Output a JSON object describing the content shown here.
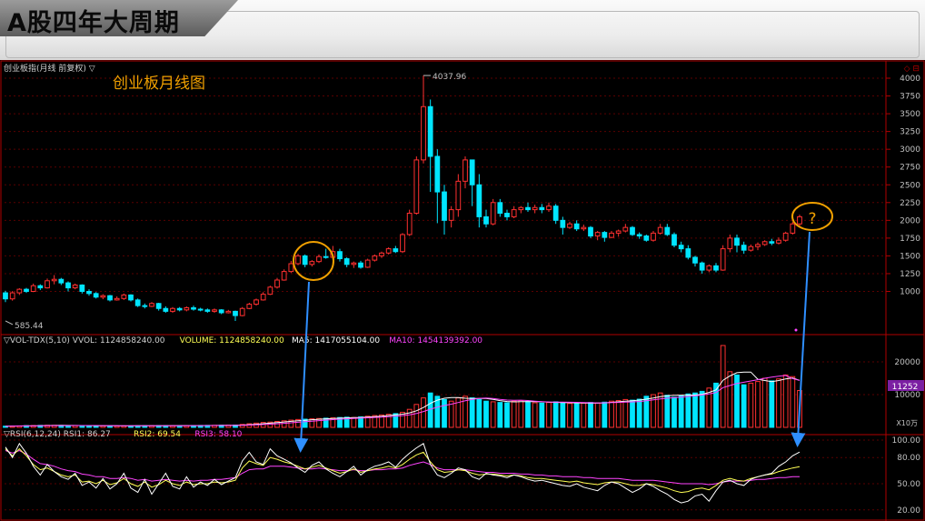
{
  "banner": {
    "title": "A股四年大周期"
  },
  "header": {
    "instrument": "创业板指(月线 前复权) ▽",
    "corner_marks": "◇ ⊟"
  },
  "annotation": {
    "title": "创业板月线图",
    "question": "?"
  },
  "colors": {
    "up": "#ff3030",
    "down": "#00e5ff",
    "ma5": "#ffffff",
    "ma10": "#ff44ff",
    "rsi1": "#ffffff",
    "rsi2": "#ffff55",
    "rsi3": "#ff44ff",
    "highlight": "#f0a000",
    "arrow": "#2f8fff"
  },
  "vol_legend": [
    {
      "text": "▽VOL-TDX(5,10) VVOL: 1124858240.00",
      "color": "#d0d0d0"
    },
    {
      "text": "VOLUME: 1124858240.00",
      "color": "#ffff55"
    },
    {
      "text": "MA5: 1417055104.00",
      "color": "#ffffff"
    },
    {
      "text": "MA10: 1454139392.00",
      "color": "#ff44ff"
    }
  ],
  "rsi_legend": [
    {
      "text": "▽RSI(6,12,24) RSI1: 86.27",
      "color": "#d0d0d0"
    },
    {
      "text": "RSI2: 69.54",
      "color": "#ffff55"
    },
    {
      "text": "RSI3: 58.10",
      "color": "#ff44ff"
    }
  ],
  "chart_data": {
    "type": "candlestick",
    "price_axis": {
      "ticks": [
        "4000",
        "3750",
        "3500",
        "3250",
        "3000",
        "2750",
        "2500",
        "2250",
        "2000",
        "1750",
        "1500",
        "1250",
        "1000"
      ],
      "range": [
        700,
        4150
      ]
    },
    "volume_axis": {
      "ticks": [
        "20000",
        "10000"
      ],
      "unit": "X10万",
      "current_label": "11252",
      "range": [
        0,
        27000
      ]
    },
    "rsi_axis": {
      "ticks": [
        "100.00",
        "80.00",
        "50.00",
        "20.00"
      ],
      "range": [
        15,
        105
      ]
    },
    "markers": {
      "high": "4037.96",
      "low": "585.44"
    },
    "candles": [
      [
        980,
        895,
        1010,
        850
      ],
      [
        895,
        980,
        1005,
        870
      ],
      [
        980,
        1030,
        1045,
        950
      ],
      [
        1030,
        1000,
        1050,
        980
      ],
      [
        1000,
        1080,
        1110,
        990
      ],
      [
        1080,
        1050,
        1100,
        1020
      ],
      [
        1050,
        1150,
        1180,
        1040
      ],
      [
        1150,
        1170,
        1230,
        1100
      ],
      [
        1170,
        1120,
        1190,
        1090
      ],
      [
        1120,
        1050,
        1140,
        1000
      ],
      [
        1050,
        1090,
        1110,
        1030
      ],
      [
        1090,
        1000,
        1100,
        970
      ],
      [
        1000,
        970,
        1030,
        940
      ],
      [
        970,
        920,
        990,
        900
      ],
      [
        920,
        940,
        960,
        890
      ],
      [
        940,
        880,
        950,
        860
      ],
      [
        880,
        900,
        930,
        870
      ],
      [
        900,
        950,
        970,
        880
      ],
      [
        950,
        880,
        960,
        860
      ],
      [
        880,
        800,
        900,
        780
      ],
      [
        800,
        790,
        830,
        760
      ],
      [
        790,
        830,
        850,
        780
      ],
      [
        830,
        760,
        840,
        730
      ],
      [
        760,
        720,
        790,
        700
      ],
      [
        720,
        760,
        780,
        700
      ],
      [
        760,
        740,
        780,
        720
      ],
      [
        740,
        770,
        790,
        720
      ],
      [
        770,
        750,
        800,
        730
      ],
      [
        750,
        740,
        770,
        720
      ],
      [
        740,
        720,
        760,
        700
      ],
      [
        720,
        740,
        760,
        700
      ],
      [
        740,
        700,
        750,
        680
      ],
      [
        700,
        720,
        740,
        690
      ],
      [
        720,
        660,
        730,
        585
      ],
      [
        660,
        760,
        780,
        650
      ],
      [
        760,
        820,
        840,
        750
      ],
      [
        820,
        880,
        900,
        800
      ],
      [
        880,
        960,
        990,
        870
      ],
      [
        960,
        1060,
        1080,
        950
      ],
      [
        1060,
        1160,
        1190,
        1040
      ],
      [
        1160,
        1280,
        1310,
        1150
      ],
      [
        1280,
        1390,
        1430,
        1260
      ],
      [
        1390,
        1500,
        1530,
        1370
      ],
      [
        1500,
        1380,
        1520,
        1340
      ],
      [
        1380,
        1420,
        1440,
        1350
      ],
      [
        1420,
        1490,
        1520,
        1400
      ],
      [
        1490,
        1480,
        1600,
        1460
      ],
      [
        1480,
        1560,
        1640,
        1460
      ],
      [
        1560,
        1460,
        1600,
        1420
      ],
      [
        1460,
        1380,
        1480,
        1340
      ],
      [
        1380,
        1400,
        1420,
        1330
      ],
      [
        1400,
        1340,
        1430,
        1320
      ],
      [
        1340,
        1440,
        1460,
        1330
      ],
      [
        1440,
        1500,
        1520,
        1420
      ],
      [
        1500,
        1540,
        1560,
        1470
      ],
      [
        1540,
        1600,
        1620,
        1520
      ],
      [
        1600,
        1560,
        1640,
        1540
      ],
      [
        1560,
        1800,
        1820,
        1540
      ],
      [
        1800,
        2100,
        2150,
        1780
      ],
      [
        2100,
        2850,
        2900,
        2080
      ],
      [
        2850,
        3600,
        4037.96,
        2800
      ],
      [
        3600,
        2900,
        3700,
        2400
      ],
      [
        2900,
        2400,
        3000,
        1960
      ],
      [
        2400,
        2000,
        2500,
        1800
      ],
      [
        2000,
        2150,
        2200,
        1900
      ],
      [
        2150,
        2550,
        2650,
        2050
      ],
      [
        2550,
        2850,
        2900,
        2450
      ],
      [
        2850,
        2500,
        2850,
        2200
      ],
      [
        2500,
        2050,
        2650,
        1900
      ],
      [
        2050,
        1950,
        2150,
        1900
      ],
      [
        1950,
        2250,
        2300,
        1930
      ],
      [
        2250,
        2100,
        2300,
        2050
      ],
      [
        2100,
        2050,
        2150,
        2000
      ],
      [
        2050,
        2150,
        2200,
        2030
      ],
      [
        2150,
        2180,
        2200,
        2100
      ],
      [
        2180,
        2150,
        2250,
        2120
      ],
      [
        2150,
        2180,
        2220,
        2100
      ],
      [
        2180,
        2150,
        2230,
        2100
      ],
      [
        2150,
        2200,
        2250,
        2120
      ],
      [
        2200,
        2000,
        2230,
        1950
      ],
      [
        2000,
        1900,
        2050,
        1800
      ],
      [
        1900,
        1950,
        1980,
        1880
      ],
      [
        1950,
        1880,
        2000,
        1850
      ],
      [
        1880,
        1900,
        1940,
        1850
      ],
      [
        1900,
        1780,
        1920,
        1750
      ],
      [
        1780,
        1830,
        1850,
        1720
      ],
      [
        1830,
        1760,
        1850,
        1700
      ],
      [
        1760,
        1820,
        1850,
        1750
      ],
      [
        1820,
        1850,
        1870,
        1770
      ],
      [
        1850,
        1900,
        1950,
        1830
      ],
      [
        1900,
        1800,
        1920,
        1780
      ],
      [
        1800,
        1780,
        1830,
        1740
      ],
      [
        1780,
        1720,
        1800,
        1700
      ],
      [
        1720,
        1820,
        1850,
        1700
      ],
      [
        1820,
        1900,
        1950,
        1800
      ],
      [
        1900,
        1800,
        1950,
        1780
      ],
      [
        1800,
        1650,
        1830,
        1620
      ],
      [
        1650,
        1600,
        1700,
        1550
      ],
      [
        1600,
        1480,
        1650,
        1450
      ],
      [
        1480,
        1400,
        1500,
        1350
      ],
      [
        1400,
        1300,
        1420,
        1250
      ],
      [
        1300,
        1360,
        1380,
        1270
      ],
      [
        1360,
        1300,
        1400,
        1270
      ],
      [
        1300,
        1600,
        1650,
        1290
      ],
      [
        1600,
        1750,
        1800,
        1550
      ],
      [
        1750,
        1650,
        1800,
        1550
      ],
      [
        1650,
        1580,
        1700,
        1530
      ],
      [
        1580,
        1630,
        1660,
        1560
      ],
      [
        1630,
        1660,
        1690,
        1580
      ],
      [
        1660,
        1700,
        1720,
        1640
      ],
      [
        1700,
        1680,
        1740,
        1650
      ],
      [
        1680,
        1720,
        1760,
        1660
      ],
      [
        1720,
        1820,
        1840,
        1700
      ],
      [
        1820,
        1950,
        1980,
        1800
      ],
      [
        1950,
        2050,
        2080,
        1900
      ]
    ],
    "volume": [
      360,
      400,
      450,
      520,
      560,
      600,
      640,
      620,
      580,
      540,
      520,
      500,
      480,
      460,
      470,
      450,
      440,
      460,
      470,
      480,
      500,
      520,
      540,
      520,
      500,
      520,
      540,
      560,
      580,
      600,
      620,
      640,
      680,
      700,
      900,
      1100,
      1300,
      1500,
      1600,
      1800,
      2000,
      2200,
      2400,
      2500,
      2600,
      2700,
      2800,
      2900,
      3000,
      3100,
      3000,
      3200,
      3400,
      3600,
      3800,
      4000,
      4200,
      4600,
      5500,
      7000,
      9000,
      10500,
      9500,
      8500,
      8000,
      9000,
      9500,
      9000,
      8500,
      8000,
      7800,
      7600,
      7500,
      8000,
      8200,
      7900,
      7500,
      7400,
      7600,
      7800,
      7500,
      7300,
      7200,
      7400,
      7600,
      7500,
      7700,
      8000,
      8200,
      8500,
      8300,
      8600,
      9500,
      10000,
      10500,
      9800,
      9200,
      9600,
      10200,
      10500,
      11000,
      12000,
      13500,
      25000,
      17000,
      16000,
      13000,
      13500,
      14000,
      15000,
      14200,
      14800,
      16000,
      15500,
      11252
    ],
    "rsi": {
      "rsi1": [
        92,
        80,
        96,
        85,
        70,
        60,
        72,
        64,
        58,
        55,
        62,
        48,
        52,
        45,
        56,
        44,
        50,
        62,
        45,
        40,
        55,
        38,
        50,
        62,
        47,
        44,
        58,
        46,
        52,
        48,
        55,
        49,
        53,
        57,
        76,
        86,
        75,
        72,
        90,
        82,
        78,
        74,
        68,
        63,
        71,
        75,
        67,
        62,
        58,
        64,
        70,
        60,
        66,
        70,
        72,
        75,
        69,
        78,
        85,
        91,
        96,
        72,
        60,
        57,
        62,
        68,
        66,
        58,
        55,
        62,
        60,
        59,
        57,
        60,
        58,
        55,
        53,
        54,
        52,
        50,
        48,
        47,
        50,
        46,
        44,
        42,
        48,
        52,
        50,
        45,
        40,
        44,
        50,
        47,
        42,
        38,
        32,
        28,
        30,
        36,
        38,
        30,
        42,
        52,
        54,
        50,
        48,
        55,
        58,
        60,
        62,
        70,
        75,
        82,
        86.27
      ],
      "rsi2": [
        90,
        82,
        90,
        82,
        72,
        66,
        68,
        64,
        60,
        58,
        60,
        52,
        53,
        50,
        54,
        49,
        51,
        56,
        50,
        47,
        52,
        46,
        49,
        54,
        50,
        48,
        52,
        49,
        50,
        50,
        52,
        51,
        52,
        54,
        68,
        76,
        73,
        71,
        80,
        78,
        75,
        73,
        70,
        67,
        69,
        71,
        68,
        65,
        62,
        64,
        67,
        63,
        65,
        67,
        68,
        70,
        68,
        72,
        78,
        83,
        86,
        75,
        66,
        63,
        64,
        66,
        65,
        62,
        60,
        61,
        61,
        60,
        59,
        60,
        59,
        57,
        56,
        56,
        55,
        54,
        53,
        52,
        53,
        51,
        50,
        49,
        51,
        52,
        52,
        50,
        48,
        48,
        50,
        49,
        47,
        45,
        42,
        40,
        41,
        44,
        45,
        43,
        48,
        54,
        56,
        54,
        53,
        56,
        58,
        60,
        61,
        64,
        66,
        68,
        69.54
      ],
      "rsi3": [
        88,
        85,
        88,
        84,
        78,
        73,
        72,
        70,
        67,
        65,
        64,
        61,
        60,
        58,
        58,
        56,
        56,
        57,
        56,
        54,
        55,
        53,
        54,
        55,
        54,
        53,
        54,
        53,
        54,
        54,
        55,
        55,
        56,
        57,
        62,
        66,
        67,
        67,
        70,
        70,
        70,
        69,
        68,
        67,
        67,
        68,
        67,
        66,
        65,
        65,
        66,
        65,
        65,
        66,
        66,
        67,
        67,
        68,
        71,
        73,
        75,
        72,
        68,
        66,
        66,
        66,
        66,
        65,
        64,
        63,
        63,
        62,
        62,
        62,
        61,
        61,
        60,
        60,
        59,
        59,
        58,
        58,
        58,
        57,
        57,
        56,
        56,
        56,
        56,
        55,
        54,
        54,
        54,
        54,
        53,
        52,
        51,
        50,
        50,
        50,
        50,
        49,
        50,
        52,
        53,
        53,
        53,
        54,
        55,
        55,
        56,
        57,
        57,
        58,
        58.1
      ]
    }
  }
}
